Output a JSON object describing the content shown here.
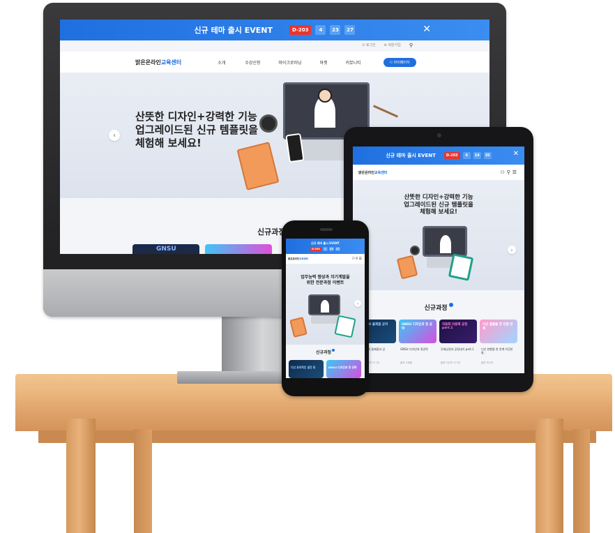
{
  "banner": {
    "title": "신규 테마 출시 EVENT",
    "dday": "D-203",
    "counters": [
      "4",
      "23",
      "27"
    ],
    "tablet_counters": [
      "4",
      "14",
      "35"
    ],
    "close": "✕"
  },
  "topbar": {
    "links": [
      "⊙ 로그인",
      "⊕ 회원가입"
    ],
    "search_icon": "search-icon"
  },
  "site": {
    "logo_plain": "밝은온라인",
    "logo_accent": "교육센터",
    "nav": [
      "소개",
      "수강신청",
      "마이크로러닝",
      "마켓",
      "커뮤니티"
    ],
    "cta": "⚇ 마이페이지"
  },
  "hero": {
    "line1": "산뜻한 디자인+강력한 기능",
    "line2": "업그레이드된 신규 템플릿을",
    "line3": "체험해 보세요!"
  },
  "phone_hero": {
    "line1": "업무능력 향상과 자기계발을",
    "line2": "위한 전문과정 이벤트"
  },
  "section": {
    "title": "신규과정"
  },
  "tablet_cards": [
    {
      "cover": "GNSU 율제품 공약",
      "title": "GNSU의 물제품과 공 ",
      "meta": "출처  자신만 리 1부"
    },
    {
      "cover": "GNSU 디자인과 정 공략",
      "title": "GNSU 디자인과 정공략",
      "meta": "출처  주제원"
    },
    {
      "cover": "자동화 이용해 공정 part.1",
      "title": "무제상권과 공정내기 part.1",
      "meta": "출처  이인지 식 1부"
    },
    {
      "cover": "디넌 휠불을 한 연결 창제",
      "title": "디넌 현행을 한 연계 이곳만 발..",
      "meta": "출처  자신저"
    }
  ],
  "phone_cards": [
    {
      "cover": "디넌 효과적인 설전 및"
    },
    {
      "cover": "GNSU 디자인과 정 공략"
    }
  ],
  "monitor_cards": [
    {
      "cover": "GNSU"
    },
    {
      "cover": ""
    }
  ],
  "colors": {
    "brand": "#1f6fe0",
    "badge": "#e8362f",
    "counter": "#5aa0f4"
  }
}
